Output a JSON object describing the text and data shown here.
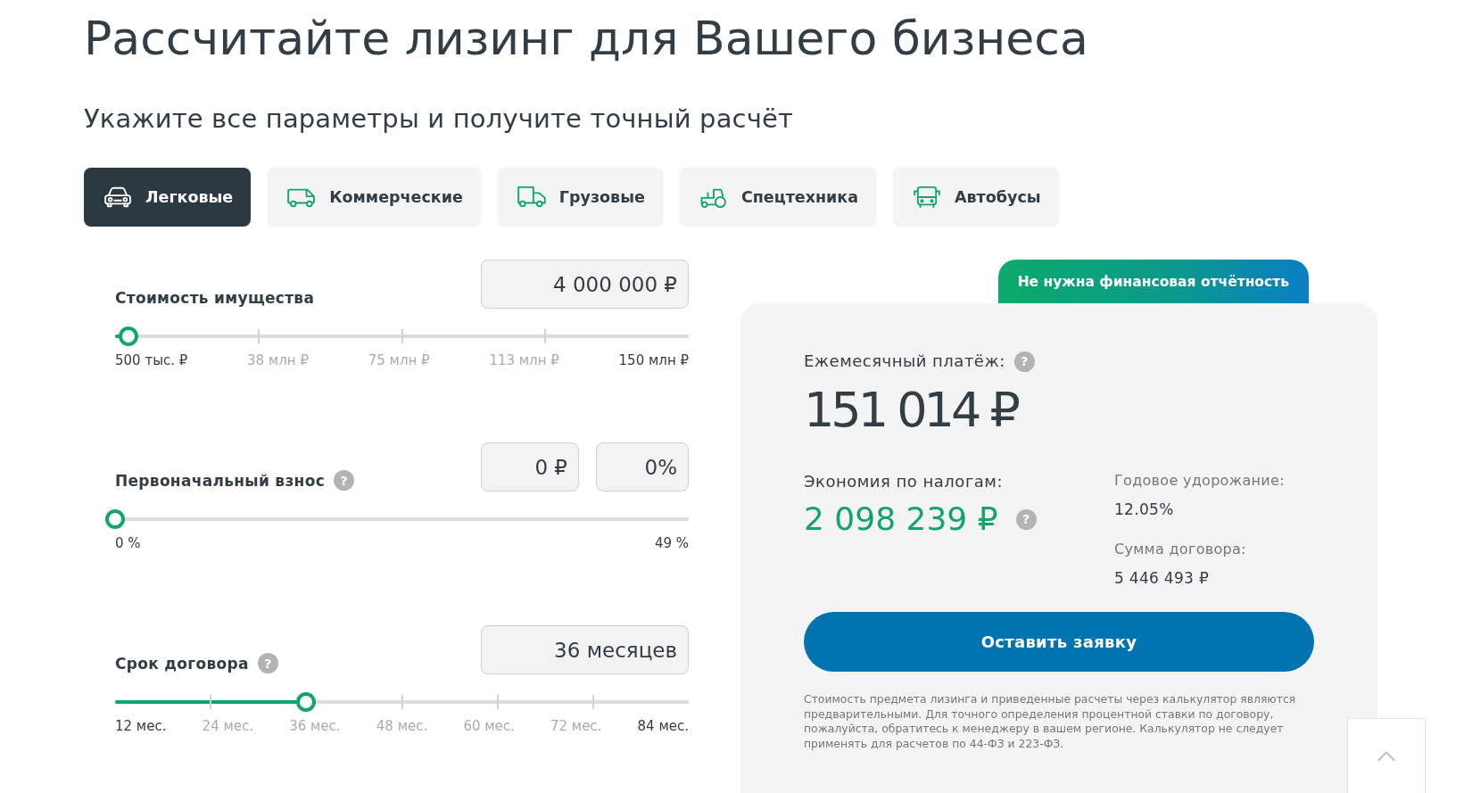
{
  "page": {
    "title": "Рассчитайте лизинг для Вашего бизнеса",
    "subtitle": "Укажите все параметры и получите точный расчёт"
  },
  "vehicle_tabs": [
    {
      "label": "Легковые",
      "selected": true
    },
    {
      "label": "Коммерческие",
      "selected": false
    },
    {
      "label": "Грузовые",
      "selected": false
    },
    {
      "label": "Спецтехника",
      "selected": false
    },
    {
      "label": "Автобусы",
      "selected": false
    }
  ],
  "parameters": [
    {
      "label": "Стоимость имущества",
      "fields": [
        "4 000 000 ₽"
      ],
      "slider": {
        "level": 0.023,
        "scale": [
          "500 тыс. ₽",
          "38 млн ₽",
          "75 млн ₽",
          "113 млн ₽",
          "150 млн ₽"
        ]
      }
    },
    {
      "label": "Первоначальный взнос",
      "help_icon": "?",
      "fields": [
        "0 ₽",
        "0%"
      ],
      "slider": {
        "level": 0,
        "scale": [
          "0 %",
          "49 %"
        ]
      }
    },
    {
      "label": "Срок договора",
      "help_icon": "?",
      "fields": [
        "36 месяцев"
      ],
      "slider": {
        "level": 0.333,
        "scale": [
          "12 мес.",
          "24 мес.",
          "36 мес.",
          "48 мес.",
          "60 мес.",
          "72 мес.",
          "84 мес."
        ]
      }
    }
  ],
  "result": {
    "badge": "Не нужна финансовая отчётность",
    "monthly_payment": {
      "label": "Ежемесячный платёж:",
      "help_icon": "?",
      "value": "151 014 ₽"
    },
    "tax_savings": {
      "label": "Экономия по налогам:",
      "value": "2 098 239 ₽",
      "help_icon": "?"
    },
    "annual_appreciation": {
      "label": "Годовое удорожание:",
      "value": "12.05%"
    },
    "contract_amount": {
      "label": "Сумма договора:",
      "value": "5 446 493 ₽"
    },
    "apply_button": "Оставить заявку",
    "disclaimer": "Стоимость предмета лизинга и приведенные расчеты через калькулятор являются предварительными. Для точного определения процентной ставки по договору, пожалуйста, обратитесь к менеджеру в вашем регионе. Калькулятор не следует применять для расчетов по 44-ФЗ и 223-ФЗ."
  }
}
